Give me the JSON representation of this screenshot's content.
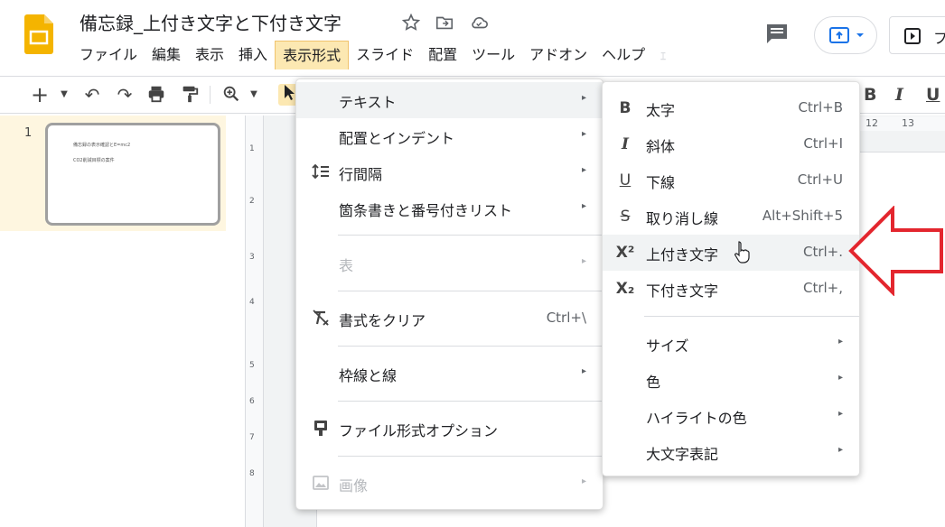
{
  "doc": {
    "title": "備忘録_上付き文字と下付き文字"
  },
  "menubar": [
    {
      "label": "ファイル"
    },
    {
      "label": "編集"
    },
    {
      "label": "表示"
    },
    {
      "label": "挿入"
    },
    {
      "label": "表示形式",
      "active": true
    },
    {
      "label": "スライド"
    },
    {
      "label": "配置"
    },
    {
      "label": "ツール"
    },
    {
      "label": "アドオン"
    },
    {
      "label": "ヘルプ"
    },
    {
      "label": "ｪ"
    }
  ],
  "header": {
    "slideshow_label": "フ"
  },
  "toolbar": {
    "bold": "B",
    "italic": "I",
    "underline": "U"
  },
  "ruler": {
    "h_marks": [
      "12",
      "13"
    ],
    "v_marks": [
      "1",
      "2",
      "3",
      "4",
      "5",
      "6",
      "7",
      "8"
    ]
  },
  "filmstrip": {
    "slide_number": "1",
    "thumb_lines": [
      "備忘録の表示確認とE=mc2",
      "CO2削減目標の案件"
    ]
  },
  "format_menu": {
    "items": [
      {
        "label": "テキスト",
        "arrow": "▸",
        "highlight": true
      },
      {
        "label": "配置とインデント",
        "arrow": "▸"
      },
      {
        "label": "行間隔",
        "arrow": "▸",
        "icon": "line-spacing-icon"
      },
      {
        "label": "箇条書きと番号付きリスト",
        "arrow": "▸"
      },
      {
        "label": "表",
        "arrow": "▸",
        "disabled": true
      },
      {
        "label": "書式をクリア",
        "shortcut": "Ctrl+\\",
        "icon": "clear-format-icon"
      },
      {
        "label": "枠線と線",
        "arrow": "▸"
      },
      {
        "label": "ファイル形式オプション",
        "icon": "format-options-icon"
      },
      {
        "label": "画像",
        "arrow": "▸",
        "disabled": true,
        "icon": "image-icon"
      }
    ]
  },
  "text_submenu": {
    "items": [
      {
        "label": "太字",
        "shortcut": "Ctrl+B",
        "icon_glyph": "B"
      },
      {
        "label": "斜体",
        "shortcut": "Ctrl+I",
        "icon_glyph": "I"
      },
      {
        "label": "下線",
        "shortcut": "Ctrl+U",
        "icon_glyph": "U"
      },
      {
        "label": "取り消し線",
        "shortcut": "Alt+Shift+5",
        "icon_glyph": "S"
      },
      {
        "label": "上付き文字",
        "shortcut": "Ctrl+.",
        "icon_glyph": "X²",
        "highlight": true
      },
      {
        "label": "下付き文字",
        "shortcut": "Ctrl+,",
        "icon_glyph": "X₂"
      },
      {
        "label": "サイズ",
        "arrow": "▸"
      },
      {
        "label": "色",
        "arrow": "▸"
      },
      {
        "label": "ハイライトの色",
        "arrow": "▸"
      },
      {
        "label": "大文字表記",
        "arrow": "▸"
      }
    ]
  },
  "colors": {
    "annotation_arrow": "#e3262e",
    "menu_highlight": "#f1f3f4",
    "active_menu": "#fce8b2",
    "logo": "#f4b400",
    "accent_blue": "#1a73e8"
  }
}
